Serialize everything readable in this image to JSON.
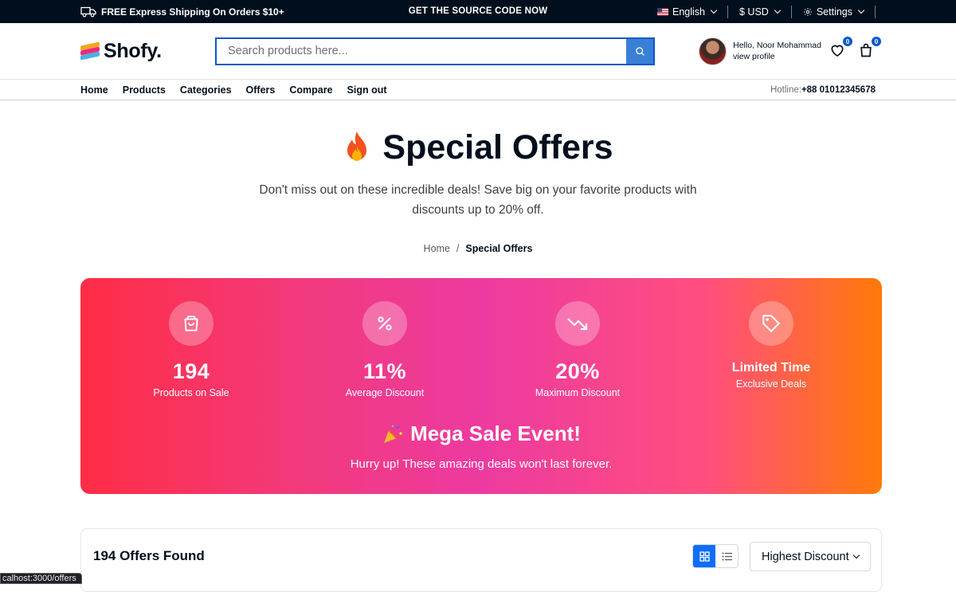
{
  "topbar": {
    "shipping": "FREE Express Shipping On Orders $10+",
    "promo": "GET THE SOURCE CODE NOW",
    "language": "English",
    "currency": "$ USD",
    "settings": "Settings"
  },
  "header": {
    "logo": "Shofy.",
    "search_placeholder": "Search products here...",
    "greeting": "Hello, Noor Mohammad",
    "profile_link": "view profile",
    "wishlist_count": "0",
    "cart_count": "0"
  },
  "nav": {
    "items": [
      "Home",
      "Products",
      "Categories",
      "Offers",
      "Compare",
      "Sign out"
    ],
    "hotline_label": "Hotline:",
    "hotline_number": "+88 01012345678"
  },
  "hero": {
    "title": "Special Offers",
    "subtitle": "Don't miss out on these incredible deals! Save big on your favorite products with discounts up to 20% off.",
    "breadcrumb_home": "Home",
    "breadcrumb_sep": "/",
    "breadcrumb_current": "Special Offers"
  },
  "banner": {
    "stats": [
      {
        "value": "194",
        "label": "Products on Sale",
        "icon": "shopping-bag-icon"
      },
      {
        "value": "11%",
        "label": "Average Discount",
        "icon": "percent-icon"
      },
      {
        "value": "20%",
        "label": "Maximum Discount",
        "icon": "trending-down-icon"
      },
      {
        "value": "Limited Time",
        "label": "Exclusive Deals",
        "icon": "tag-icon"
      }
    ],
    "event_title": "Mega Sale Event!",
    "event_subtitle": "Hurry up! These amazing deals won't last forever."
  },
  "results": {
    "count_text": "194 Offers Found",
    "sort_value": "Highest Discount"
  },
  "statusbar": "calhost:3000/offers",
  "colors": {
    "accent": "#0a58ca",
    "topbar": "#010f1c",
    "banner_start": "#ff2d45",
    "banner_mid": "#ed3aa0",
    "banner_end": "#ff7a09"
  }
}
